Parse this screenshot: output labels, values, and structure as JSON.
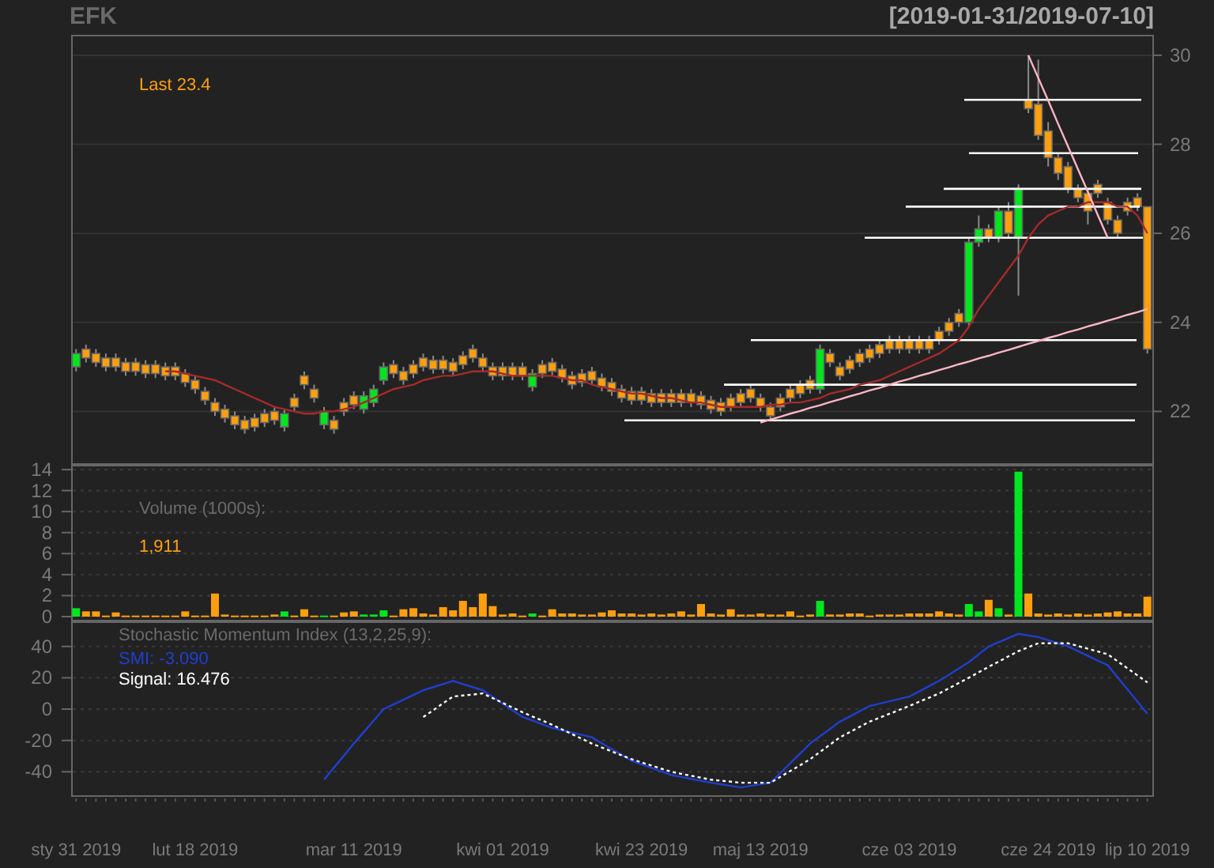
{
  "header": {
    "symbol": "EFK",
    "date_range": "[2019-01-31/2019-07-10]"
  },
  "price_panel": {
    "last_label": "Last 23.4",
    "chart_data": {
      "type": "candlestick",
      "ylim": [
        20.8,
        30.46
      ],
      "yticks": [
        22,
        24,
        26,
        28,
        30
      ],
      "grid": true,
      "ohlc": [
        [
          23.0,
          23.4,
          22.9,
          23.3
        ],
        [
          23.4,
          23.5,
          23.1,
          23.2
        ],
        [
          23.3,
          23.4,
          23.0,
          23.1
        ],
        [
          23.2,
          23.3,
          22.9,
          23.0
        ],
        [
          23.2,
          23.3,
          22.9,
          23.0
        ],
        [
          23.1,
          23.2,
          22.8,
          22.9
        ],
        [
          23.1,
          23.2,
          22.8,
          22.9
        ],
        [
          23.05,
          23.15,
          22.75,
          22.85
        ],
        [
          23.05,
          23.15,
          22.75,
          22.85
        ],
        [
          23.0,
          23.1,
          22.7,
          22.8
        ],
        [
          23.0,
          23.1,
          22.7,
          22.8
        ],
        [
          22.85,
          22.95,
          22.55,
          22.65
        ],
        [
          22.7,
          22.8,
          22.4,
          22.5
        ],
        [
          22.45,
          22.55,
          22.15,
          22.25
        ],
        [
          22.2,
          22.3,
          21.9,
          22.0
        ],
        [
          22.05,
          22.15,
          21.75,
          21.85
        ],
        [
          21.9,
          22.0,
          21.6,
          21.7
        ],
        [
          21.8,
          21.9,
          21.5,
          21.6
        ],
        [
          21.85,
          21.95,
          21.55,
          21.65
        ],
        [
          21.95,
          22.05,
          21.65,
          21.75
        ],
        [
          22.0,
          22.1,
          21.7,
          21.8
        ],
        [
          21.65,
          22.05,
          21.55,
          21.95
        ],
        [
          22.3,
          22.4,
          22.0,
          22.1
        ],
        [
          22.8,
          22.9,
          22.5,
          22.6
        ],
        [
          22.5,
          22.6,
          22.2,
          22.3
        ],
        [
          21.7,
          22.1,
          21.6,
          22.0
        ],
        [
          21.8,
          21.9,
          21.5,
          21.6
        ],
        [
          22.2,
          22.3,
          21.9,
          22.0
        ],
        [
          22.35,
          22.45,
          22.05,
          22.15
        ],
        [
          22.05,
          22.45,
          21.95,
          22.35
        ],
        [
          22.2,
          22.6,
          22.1,
          22.5
        ],
        [
          22.7,
          23.1,
          22.6,
          23.0
        ],
        [
          23.05,
          23.15,
          22.75,
          22.85
        ],
        [
          22.9,
          23.0,
          22.6,
          22.7
        ],
        [
          23.05,
          23.15,
          22.75,
          22.85
        ],
        [
          23.2,
          23.3,
          22.9,
          23.0
        ],
        [
          23.15,
          23.25,
          22.85,
          22.95
        ],
        [
          23.15,
          23.25,
          22.85,
          22.95
        ],
        [
          23.1,
          23.2,
          22.8,
          22.9
        ],
        [
          23.25,
          23.35,
          22.95,
          23.05
        ],
        [
          23.4,
          23.5,
          23.1,
          23.2
        ],
        [
          23.2,
          23.3,
          22.9,
          23.0
        ],
        [
          23.0,
          23.1,
          22.7,
          22.8
        ],
        [
          23.0,
          23.1,
          22.7,
          22.8
        ],
        [
          23.0,
          23.1,
          22.7,
          22.8
        ],
        [
          23.0,
          23.1,
          22.7,
          22.8
        ],
        [
          22.55,
          22.95,
          22.45,
          22.85
        ],
        [
          23.05,
          23.15,
          22.75,
          22.85
        ],
        [
          23.1,
          23.2,
          22.8,
          22.9
        ],
        [
          22.95,
          23.05,
          22.65,
          22.75
        ],
        [
          22.8,
          22.9,
          22.5,
          22.6
        ],
        [
          22.85,
          22.95,
          22.55,
          22.65
        ],
        [
          22.9,
          23.0,
          22.6,
          22.7
        ],
        [
          22.75,
          22.85,
          22.45,
          22.55
        ],
        [
          22.65,
          22.75,
          22.35,
          22.45
        ],
        [
          22.5,
          22.6,
          22.2,
          22.3
        ],
        [
          22.45,
          22.55,
          22.15,
          22.25
        ],
        [
          22.45,
          22.55,
          22.15,
          22.25
        ],
        [
          22.4,
          22.5,
          22.1,
          22.2
        ],
        [
          22.4,
          22.5,
          22.1,
          22.2
        ],
        [
          22.4,
          22.5,
          22.1,
          22.2
        ],
        [
          22.4,
          22.5,
          22.1,
          22.2
        ],
        [
          22.4,
          22.5,
          22.1,
          22.2
        ],
        [
          22.35,
          22.45,
          22.05,
          22.15
        ],
        [
          22.25,
          22.35,
          21.95,
          22.05
        ],
        [
          22.2,
          22.3,
          21.9,
          22.0
        ],
        [
          22.3,
          22.4,
          22.0,
          22.1
        ],
        [
          22.4,
          22.5,
          22.1,
          22.2
        ],
        [
          22.5,
          22.6,
          22.2,
          22.3
        ],
        [
          22.3,
          22.4,
          22.0,
          22.1
        ],
        [
          22.1,
          22.2,
          21.8,
          21.9
        ],
        [
          22.3,
          22.4,
          22.0,
          22.1
        ],
        [
          22.5,
          22.6,
          22.2,
          22.3
        ],
        [
          22.6,
          22.7,
          22.3,
          22.4
        ],
        [
          22.7,
          22.8,
          22.4,
          22.5
        ],
        [
          22.5,
          23.5,
          22.4,
          23.4
        ],
        [
          23.3,
          23.4,
          23.0,
          23.1
        ],
        [
          23.0,
          23.1,
          22.7,
          22.8
        ],
        [
          23.15,
          23.25,
          22.85,
          22.95
        ],
        [
          23.3,
          23.4,
          23.0,
          23.1
        ],
        [
          23.4,
          23.5,
          23.1,
          23.2
        ],
        [
          23.5,
          23.6,
          23.2,
          23.3
        ],
        [
          23.6,
          23.7,
          23.3,
          23.4
        ],
        [
          23.6,
          23.7,
          23.3,
          23.4
        ],
        [
          23.6,
          23.7,
          23.3,
          23.4
        ],
        [
          23.6,
          23.7,
          23.3,
          23.4
        ],
        [
          23.6,
          23.7,
          23.3,
          23.4
        ],
        [
          23.8,
          23.9,
          23.5,
          23.6
        ],
        [
          24.0,
          24.1,
          23.7,
          23.8
        ],
        [
          24.2,
          24.3,
          23.9,
          24.0
        ],
        [
          24.0,
          25.9,
          23.9,
          25.8
        ],
        [
          25.8,
          26.4,
          25.7,
          26.1
        ],
        [
          26.1,
          26.2,
          25.8,
          25.9
        ],
        [
          25.9,
          26.6,
          25.8,
          26.5
        ],
        [
          26.5,
          26.7,
          25.9,
          26.0
        ],
        [
          25.9,
          27.1,
          24.6,
          27.0
        ],
        [
          29.0,
          30.0,
          28.7,
          28.8
        ],
        [
          28.9,
          29.9,
          28.1,
          28.2
        ],
        [
          28.3,
          28.5,
          27.5,
          27.7
        ],
        [
          27.7,
          27.8,
          27.2,
          27.35
        ],
        [
          27.5,
          27.6,
          26.9,
          27.0
        ],
        [
          27.0,
          27.1,
          26.7,
          26.8
        ],
        [
          26.9,
          27.0,
          26.2,
          26.5
        ],
        [
          27.1,
          27.2,
          26.8,
          26.9
        ],
        [
          26.7,
          26.8,
          26.2,
          26.3
        ],
        [
          26.3,
          26.4,
          25.9,
          26.0
        ],
        [
          26.7,
          26.8,
          26.4,
          26.5
        ],
        [
          26.8,
          26.9,
          26.5,
          26.6
        ],
        [
          26.6,
          26.6,
          23.3,
          23.4
        ]
      ],
      "ref_lines": [
        {
          "axis": "y",
          "value": 29.0,
          "color": "#ffffff"
        },
        {
          "axis": "y",
          "value": 27.8,
          "color": "#ffffff"
        },
        {
          "axis": "y",
          "value": 27.0,
          "color": "#ffffff"
        },
        {
          "axis": "y",
          "value": 26.6,
          "color": "#ffffff"
        },
        {
          "axis": "y",
          "value": 25.9,
          "color": "#ffffff"
        },
        {
          "axis": "y",
          "value": 23.6,
          "color": "#ffffff"
        },
        {
          "axis": "y",
          "value": 22.6,
          "color": "#ffffff"
        },
        {
          "axis": "y",
          "value": 21.8,
          "color": "#ffffff"
        }
      ]
    },
    "overlay": {
      "chart_data": {
        "type": "line",
        "ylim": [
          20.8,
          30.46
        ],
        "series": [
          {
            "color": "#a52a2a",
            "line_style": "solid",
            "values": [
              null,
              null,
              null,
              null,
              null,
              null,
              null,
              null,
              null,
              22.9,
              22.9,
              22.85,
              22.8,
              22.75,
              22.7,
              22.6,
              22.5,
              22.4,
              22.3,
              22.2,
              22.1,
              22.05,
              22.0,
              21.95,
              21.95,
              22.0,
              22.0,
              22.05,
              22.1,
              22.2,
              22.3,
              22.4,
              22.5,
              22.55,
              22.6,
              22.7,
              22.75,
              22.8,
              22.8,
              22.85,
              22.9,
              22.9,
              22.9,
              22.85,
              22.8,
              22.8,
              22.8,
              22.8,
              22.8,
              22.75,
              22.7,
              22.7,
              22.6,
              22.55,
              22.5,
              22.45,
              22.4,
              22.4,
              22.35,
              22.3,
              22.3,
              22.25,
              22.2,
              22.2,
              22.15,
              22.1,
              22.1,
              22.1,
              22.1,
              22.1,
              22.15,
              22.15,
              22.2,
              22.2,
              22.25,
              22.3,
              22.4,
              22.45,
              22.5,
              22.6,
              22.65,
              22.7,
              22.8,
              22.9,
              23.0,
              23.1,
              23.2,
              23.3,
              23.45,
              23.6,
              23.9,
              24.3,
              24.6,
              24.9,
              25.2,
              25.5,
              25.9,
              26.2,
              26.4,
              26.5,
              26.6,
              26.6,
              26.7,
              26.7,
              26.7,
              26.6,
              26.6,
              26.4,
              26.0
            ]
          },
          {
            "color": "#ffb6c1",
            "line_style": "solid",
            "values": [
              null,
              null,
              null,
              null,
              null,
              null,
              null,
              null,
              null,
              null,
              null,
              null,
              null,
              null,
              null,
              null,
              null,
              null,
              null,
              null,
              null,
              null,
              null,
              null,
              null,
              null,
              null,
              null,
              null,
              null,
              null,
              null,
              null,
              null,
              null,
              null,
              null,
              null,
              null,
              null,
              null,
              null,
              null,
              null,
              null,
              null,
              null,
              null,
              null,
              null,
              null,
              null,
              null,
              null,
              null,
              null,
              null,
              null,
              null,
              null,
              null,
              null,
              null,
              null,
              null,
              null,
              null,
              null,
              null,
              21.75,
              21.82,
              21.88,
              21.95,
              22.01,
              22.08,
              22.14,
              22.21,
              22.27,
              22.34,
              22.4,
              22.47,
              22.53,
              22.6,
              22.67,
              22.73,
              22.8,
              22.86,
              22.93,
              22.99,
              23.06,
              23.12,
              23.19,
              23.25,
              23.32,
              23.38,
              23.45,
              23.52,
              23.58,
              23.65,
              23.71,
              23.78,
              23.84,
              23.91,
              23.97,
              24.04,
              24.1,
              24.17,
              24.23,
              24.3
            ]
          },
          {
            "color": "#ffb6c1",
            "line_style": "solid",
            "values": [
              null,
              null,
              null,
              null,
              null,
              null,
              null,
              null,
              null,
              null,
              null,
              null,
              null,
              null,
              null,
              null,
              null,
              null,
              null,
              null,
              null,
              null,
              null,
              null,
              null,
              null,
              null,
              null,
              null,
              null,
              null,
              null,
              null,
              null,
              null,
              null,
              null,
              null,
              null,
              null,
              null,
              null,
              null,
              null,
              null,
              null,
              null,
              null,
              null,
              null,
              null,
              null,
              null,
              null,
              null,
              null,
              null,
              null,
              null,
              null,
              null,
              null,
              null,
              null,
              null,
              null,
              null,
              null,
              null,
              null,
              null,
              null,
              null,
              null,
              null,
              null,
              null,
              null,
              null,
              null,
              null,
              null,
              null,
              null,
              null,
              null,
              null,
              null,
              null,
              null,
              null,
              null,
              null,
              null,
              null,
              null,
              30.0,
              29.49,
              28.98,
              28.46,
              27.95,
              27.44,
              26.93,
              26.41,
              25.9,
              null,
              null,
              null,
              null
            ]
          }
        ]
      }
    }
  },
  "volume_panel": {
    "title": "Volume (1000s):",
    "last_value": "1,911",
    "chart_data": {
      "type": "bar",
      "ylim": [
        -0.45,
        14.45
      ],
      "yticks": [
        0,
        2,
        4,
        6,
        8,
        10,
        12,
        14
      ],
      "grid": true,
      "series": [
        {
          "color": "#00e61e",
          "values": [
            0.8,
            null,
            null,
            null,
            null,
            null,
            null,
            null,
            null,
            null,
            null,
            null,
            null,
            null,
            null,
            null,
            null,
            null,
            null,
            null,
            null,
            0.5,
            null,
            null,
            null,
            0.1,
            null,
            null,
            null,
            0.2,
            0.2,
            0.6,
            null,
            null,
            null,
            null,
            null,
            null,
            null,
            null,
            null,
            null,
            null,
            null,
            null,
            null,
            0.3,
            null,
            null,
            null,
            null,
            null,
            null,
            null,
            null,
            null,
            null,
            null,
            null,
            null,
            null,
            null,
            null,
            null,
            null,
            null,
            null,
            null,
            null,
            null,
            null,
            null,
            null,
            null,
            null,
            1.5,
            null,
            null,
            null,
            null,
            null,
            null,
            null,
            null,
            null,
            null,
            null,
            null,
            null,
            null,
            1.2,
            0.5,
            null,
            0.8,
            null,
            13.8,
            null,
            null,
            null,
            null,
            null,
            null,
            null,
            null,
            null,
            null,
            null,
            null,
            null
          ]
        },
        {
          "color": "#ff9f0f",
          "values": [
            null,
            0.5,
            0.5,
            0.1,
            0.4,
            0.1,
            0.1,
            0.1,
            0.1,
            0.1,
            0.1,
            0.5,
            0.1,
            0.1,
            2.2,
            0.2,
            0.1,
            0.1,
            0.1,
            0.1,
            0.2,
            null,
            0.1,
            0.7,
            0.1,
            null,
            0.1,
            0.4,
            0.5,
            null,
            null,
            null,
            0.1,
            0.7,
            0.8,
            0.3,
            0.2,
            0.9,
            0.6,
            1.5,
            0.9,
            2.2,
            1.0,
            0.2,
            0.3,
            0.1,
            null,
            0.1,
            0.7,
            0.3,
            0.3,
            0.2,
            0.2,
            0.4,
            0.6,
            0.3,
            0.3,
            0.2,
            0.3,
            0.2,
            0.3,
            0.5,
            0.2,
            1.2,
            0.3,
            0.2,
            0.7,
            0.2,
            0.2,
            0.3,
            0.2,
            0.2,
            0.5,
            0.1,
            0.2,
            null,
            0.2,
            0.2,
            0.3,
            0.3,
            0.1,
            0.2,
            0.2,
            0.2,
            0.3,
            0.3,
            0.3,
            0.5,
            0.3,
            0.2,
            null,
            null,
            1.6,
            null,
            0.2,
            null,
            2.2,
            0.3,
            0.2,
            0.3,
            0.2,
            0.3,
            0.2,
            0.3,
            0.4,
            0.5,
            0.3,
            0.3,
            1.9
          ]
        }
      ]
    }
  },
  "smi_panel": {
    "title": "Stochastic Momentum Index (13,2,25,9):",
    "smi_label": "SMI: -3.090",
    "signal_label": "Signal: 16.476",
    "chart_data": {
      "type": "line",
      "ylim": [
        -56,
        56
      ],
      "yticks": [
        -40,
        -20,
        0,
        20,
        40
      ],
      "grid": true,
      "categories": [
        "sty 31 2019",
        null,
        null,
        null,
        null,
        null,
        null,
        null,
        null,
        null,
        null,
        null,
        "lut 18 2019",
        null,
        null,
        null,
        null,
        null,
        null,
        null,
        null,
        null,
        null,
        null,
        null,
        null,
        null,
        null,
        "mar 11 2019",
        null,
        null,
        null,
        null,
        null,
        null,
        null,
        null,
        null,
        null,
        null,
        null,
        null,
        null,
        "kwi 01 2019",
        null,
        null,
        null,
        null,
        null,
        null,
        null,
        null,
        null,
        null,
        null,
        null,
        null,
        "kwi 23 2019",
        null,
        null,
        null,
        null,
        null,
        null,
        null,
        null,
        null,
        null,
        null,
        "maj 13 2019",
        null,
        null,
        null,
        null,
        null,
        null,
        null,
        null,
        null,
        null,
        null,
        null,
        null,
        null,
        "cze 03 2019",
        null,
        null,
        null,
        null,
        null,
        null,
        null,
        null,
        null,
        null,
        null,
        null,
        null,
        "cze 24 2019",
        null,
        null,
        null,
        null,
        null,
        null,
        null,
        null,
        null,
        "lip 10 2019"
      ],
      "series": [
        {
          "color": "#1f3fcf",
          "line_style": "solid",
          "values": [
            null,
            null,
            null,
            null,
            null,
            null,
            null,
            null,
            null,
            null,
            null,
            null,
            null,
            null,
            null,
            null,
            null,
            null,
            null,
            null,
            null,
            null,
            null,
            null,
            null,
            -45,
            -37.3,
            -29.7,
            -22,
            -14.7,
            -7.3,
            0,
            3,
            6,
            9,
            12,
            14,
            16,
            18,
            16,
            14,
            12,
            7.8,
            3.5,
            -0.8,
            -5,
            -7.3,
            -9.7,
            -12,
            -13.5,
            -15,
            -16.5,
            -18,
            -21.8,
            -25.5,
            -29.3,
            -33,
            -35.3,
            -37.5,
            -39.8,
            -42,
            -43.3,
            -44.5,
            -45.8,
            -47,
            -48,
            -49,
            -50,
            -49,
            -48,
            -47,
            -40.8,
            -34.5,
            -28.3,
            -22,
            -17.3,
            -12.7,
            -8,
            -4.7,
            -1.3,
            2,
            3.5,
            5,
            6.5,
            8,
            11.3,
            14.7,
            18,
            22,
            26,
            30,
            35,
            40,
            42.7,
            45.3,
            48,
            47,
            46,
            44,
            42,
            40,
            37,
            34,
            31,
            28,
            20.3,
            12.5,
            4.8,
            -3
          ]
        },
        {
          "color": "#ffffff",
          "line_style": "dotted",
          "values": [
            null,
            null,
            null,
            null,
            null,
            null,
            null,
            null,
            null,
            null,
            null,
            null,
            null,
            null,
            null,
            null,
            null,
            null,
            null,
            null,
            null,
            null,
            null,
            null,
            null,
            null,
            null,
            null,
            null,
            null,
            null,
            null,
            null,
            null,
            null,
            -5,
            -0.7,
            3.7,
            8,
            8.7,
            9.3,
            10,
            7,
            4,
            1,
            -2,
            -4.7,
            -7.3,
            -10,
            -13,
            -16,
            -19,
            -22,
            -24.5,
            -27,
            -29.5,
            -32,
            -34,
            -36,
            -38,
            -40,
            -41.3,
            -42.5,
            -43.8,
            -45,
            -45.7,
            -46.3,
            -47,
            -47,
            -47,
            -47,
            -43.3,
            -39.5,
            -35.8,
            -32,
            -27.3,
            -22.7,
            -18,
            -14.7,
            -11.3,
            -8,
            -5.5,
            -3,
            -0.5,
            2,
            4.7,
            7.3,
            10,
            13.3,
            16.7,
            20,
            23.5,
            27,
            30.3,
            33.7,
            37,
            39.5,
            42,
            42,
            42,
            42,
            40.3,
            38.5,
            36.8,
            35,
            30.5,
            26,
            21.5,
            17
          ]
        }
      ]
    }
  }
}
